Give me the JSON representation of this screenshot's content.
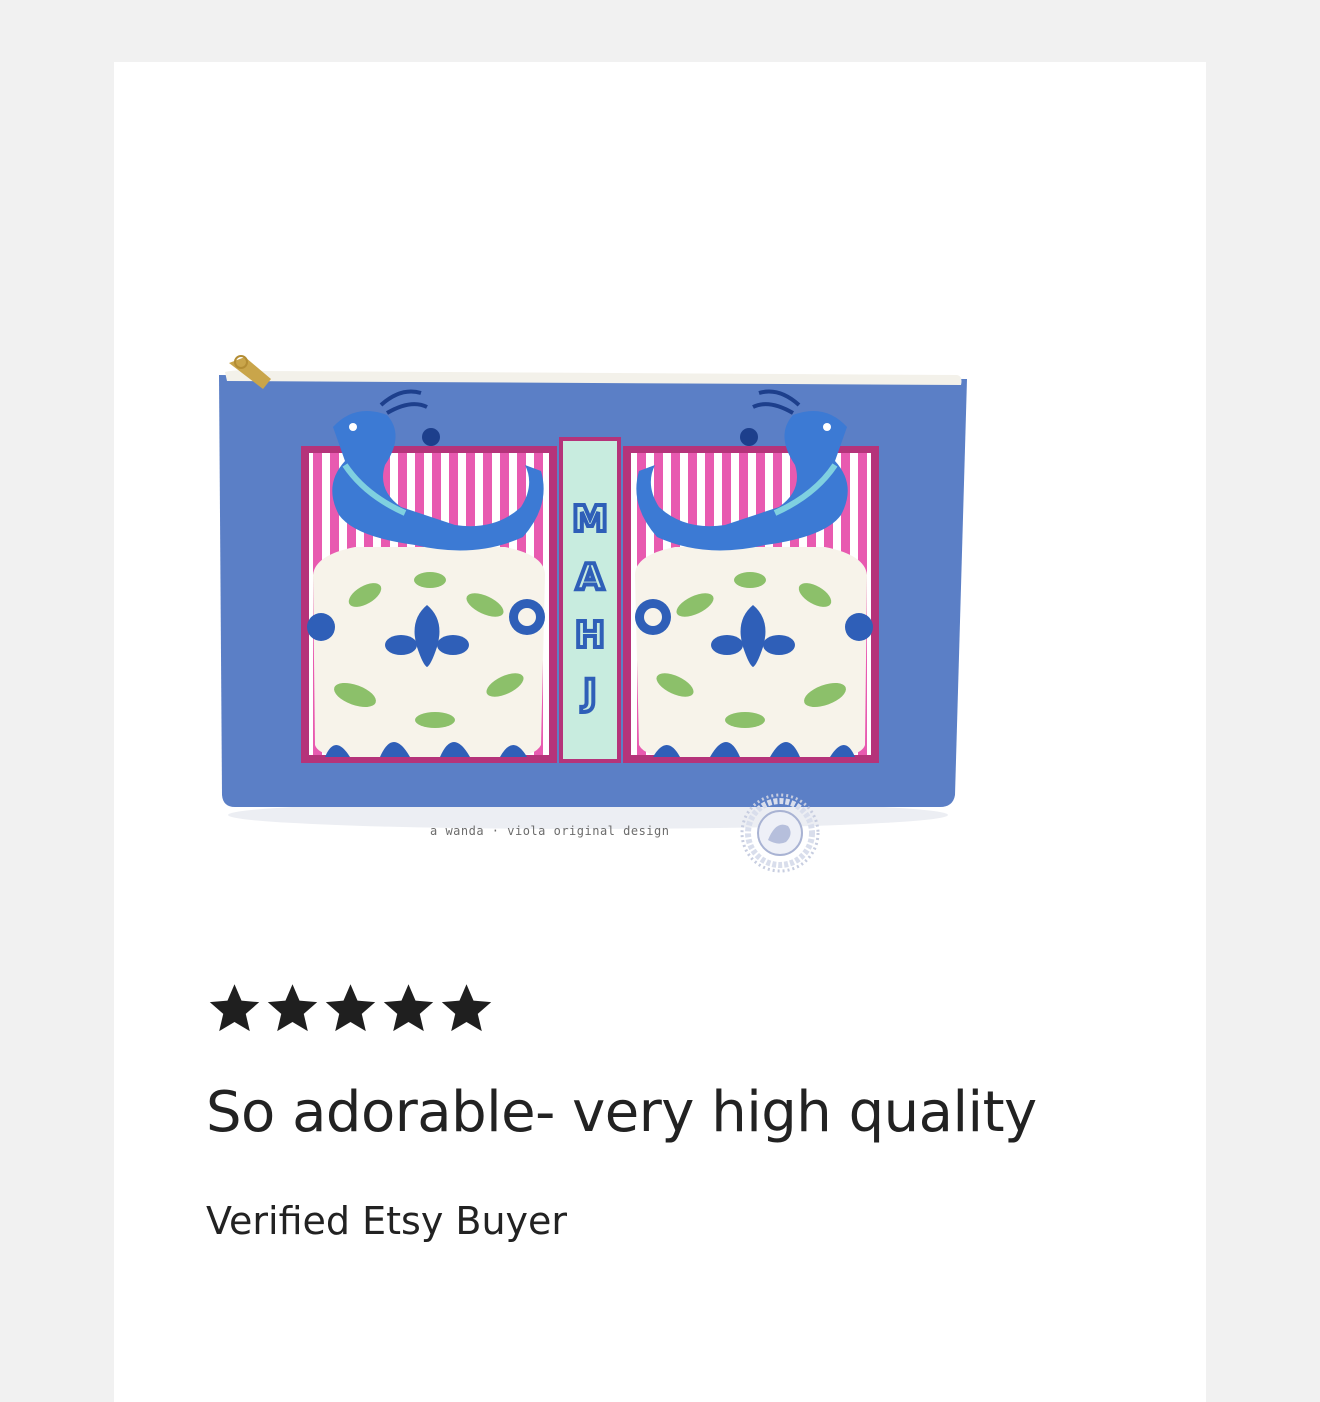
{
  "review": {
    "rating": 5,
    "rating_max": 5,
    "title": "So adorable- very high quality",
    "reviewer": "Verified Etsy Buyer"
  },
  "product_image": {
    "bag_text": "MAHJ",
    "watermark": "a wanda · viola original design",
    "seal_text": "wanda · viola"
  },
  "colors": {
    "bag_blue": "#5b7fc6",
    "stripe_pink": "#e85ab0",
    "frame_magenta": "#b5337a",
    "panel_mint": "#c8ecdf",
    "star": "#1f1f1f",
    "text": "#222222"
  }
}
